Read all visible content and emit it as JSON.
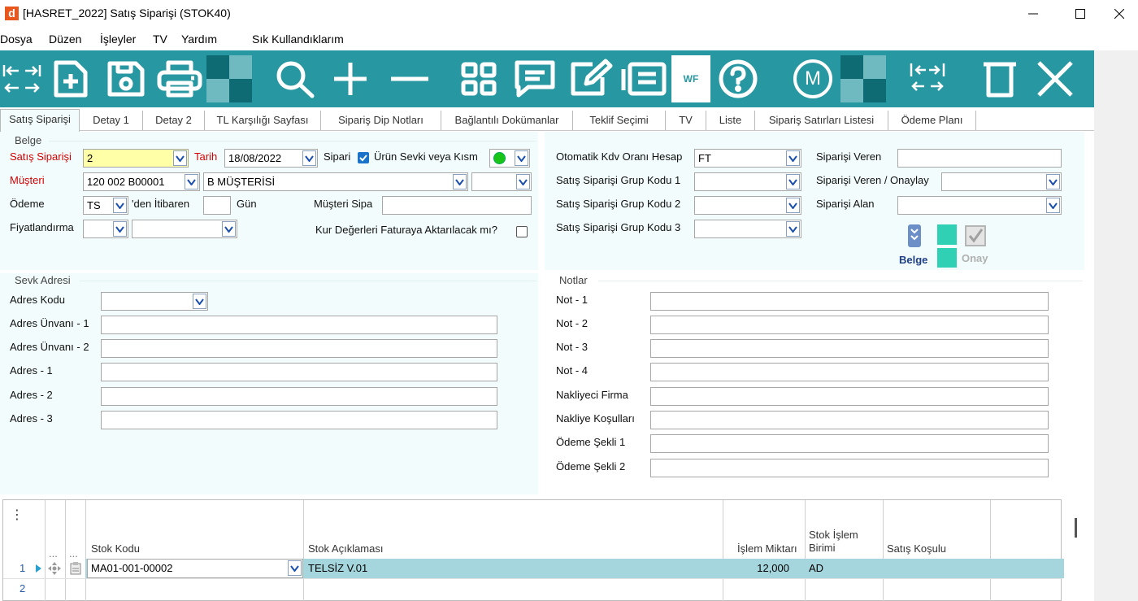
{
  "window": {
    "logo_letter": "d",
    "title": "[HASRET_2022] Satış Siparişi (STOK40)"
  },
  "menu": [
    "Dosya",
    "Düzen",
    "İşleyler",
    "TV",
    "Yardım",
    "Sık Kullandıklarım"
  ],
  "toolbar": {
    "buttons": [
      "swap-arrows-icon",
      "new-document-icon",
      "save-icon",
      "print-icon",
      "checker-icon",
      "search-icon",
      "plus-icon",
      "minus-icon",
      "grid-view-icon",
      "comment-icon",
      "edit-icon",
      "list-icon",
      "workflow-icon",
      "help-icon",
      "m-circle-icon",
      "checker-icon",
      "expand-arrows-icon",
      "delete-icon",
      "close-icon"
    ],
    "wf_label": "WF",
    "m_label": "M",
    "background": "#2797a1"
  },
  "tabs": [
    "Satış Siparişi",
    "Detay 1",
    "Detay 2",
    "TL Karşılığı Sayfası",
    "Sipariş Dip Notları",
    "Bağlantılı Dokümanlar",
    "Teklif Seçimi",
    "TV",
    "Liste",
    "Sipariş Satırları Listesi",
    "Ödeme Planı"
  ],
  "belge": {
    "group_title": "Belge",
    "satis_siparisi": {
      "label": "Satış Siparişi",
      "value": "2"
    },
    "tarih": {
      "label": "Tarih",
      "value": "18/08/2022"
    },
    "sipari_label": "Sipari",
    "urun_sevki_label": "Ürün Sevki veya Kısm",
    "musteri": {
      "label": "Müşteri",
      "code": "120 002 B00001",
      "name": "B MÜŞTERİSİ"
    },
    "odeme": {
      "label": "Ödeme",
      "value": "TS",
      "den_itibaren": "'den İtibaren",
      "gun": "Gün"
    },
    "musteri_sipa_label": "Müşteri Sipa",
    "fiyatlandirma_label": "Fiyatlandırma",
    "kur_label": "Kur Değerleri Faturaya Aktarılacak mı?"
  },
  "right_fields": {
    "kdv": {
      "label": "Otomatik Kdv Oranı Hesap",
      "value": "FT"
    },
    "grup1_label": "Satış Siparişi Grup Kodu 1",
    "grup2_label": "Satış Siparişi Grup Kodu 2",
    "grup3_label": "Satış Siparişi Grup Kodu 3",
    "veren_label": "Siparişi Veren",
    "veren_onay_label": "Siparişi Veren / Onaylay",
    "alan_label": "Siparişi Alan",
    "belge_btn": "Belge",
    "onay_btn": "Onay"
  },
  "sevk": {
    "group_title": "Sevk Adresi",
    "labels": [
      "Adres Kodu",
      "Adres Ünvanı - 1",
      "Adres Ünvanı - 2",
      "Adres - 1",
      "Adres - 2",
      "Adres - 3"
    ]
  },
  "notlar": {
    "group_title": "Notlar",
    "labels": [
      "Not - 1",
      "Not - 2",
      "Not - 3",
      "Not - 4",
      "Nakliyeci Firma",
      "Nakliye Koşulları",
      "Ödeme Şekli 1",
      "Ödeme Şekli 2"
    ]
  },
  "grid": {
    "menu_glyph": "⋮",
    "ellipsis": "...",
    "headers": {
      "stok_kodu": "Stok Kodu",
      "stok_aciklamasi": "Stok Açıklaması",
      "islem_miktari": "İşlem Miktarı",
      "stok_islem_birimi_1": "Stok İşlem",
      "stok_islem_birimi_2": "Birimi",
      "satis_kosulu": "Satış Koşulu"
    },
    "rows": [
      {
        "no": "1",
        "stok_kodu": "MA01-001-00002",
        "aciklama": "TELSİZ V.01",
        "miktar": "12,000",
        "birim": "AD",
        "kosul": ""
      },
      {
        "no": "2",
        "stok_kodu": "",
        "aciklama": "",
        "miktar": "",
        "birim": "",
        "kosul": ""
      }
    ],
    "selected_row_color": "#a6d6dd"
  }
}
